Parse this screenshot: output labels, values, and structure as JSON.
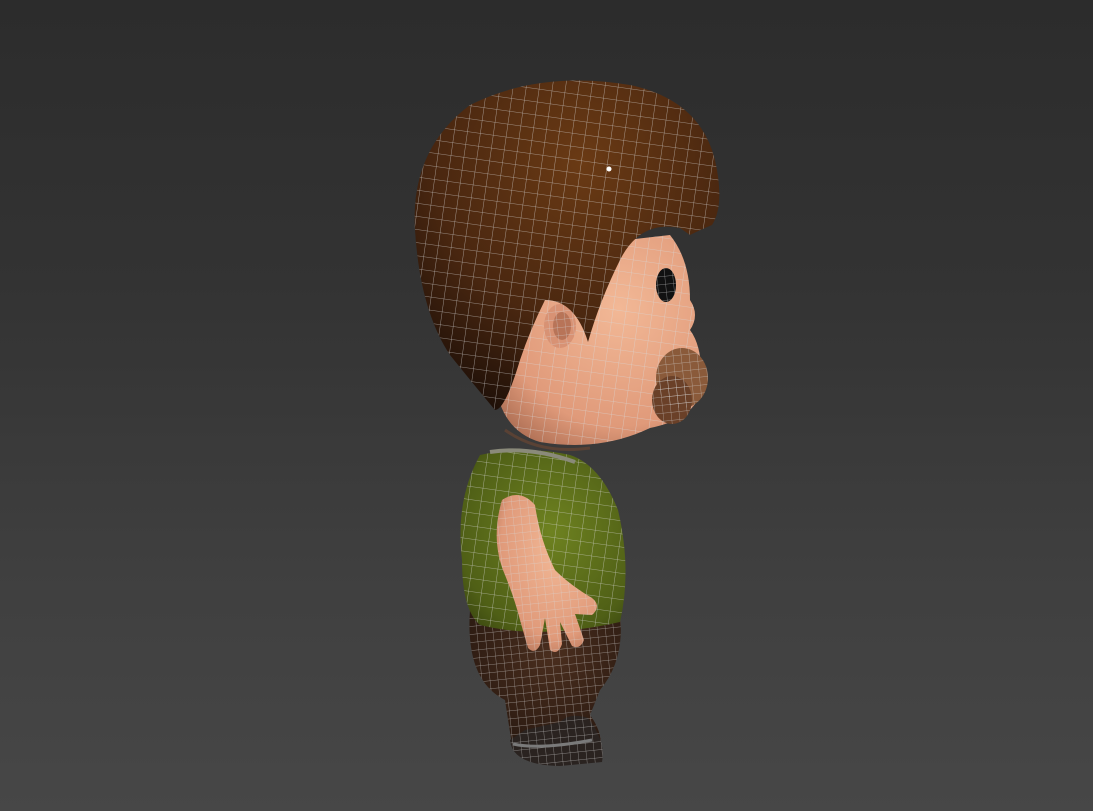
{
  "viewport": {
    "background_top": "#2c2c2c",
    "background_bottom": "#474747",
    "view": "side"
  },
  "model": {
    "subject": "cartoon-character",
    "display": "shaded-with-wireframe",
    "colors": {
      "hair": "#4a2710",
      "skin": "#e8a886",
      "shirt": "#5a6b1a",
      "pants": "#3a2418",
      "shoe": "#2a2320",
      "wire": "#d8d8d8"
    }
  }
}
